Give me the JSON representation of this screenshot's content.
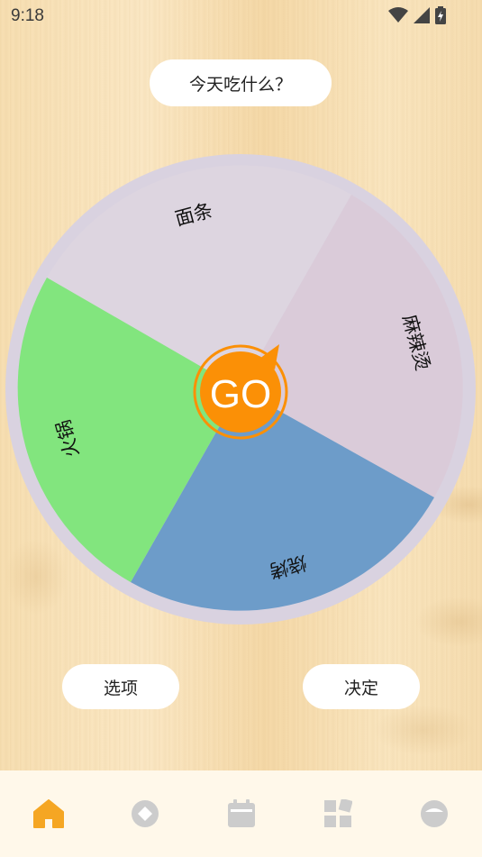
{
  "status": {
    "time": "9:18"
  },
  "header": {
    "title": "今天吃什么？"
  },
  "wheel": {
    "go_label": "GO",
    "segments": [
      {
        "label": "面条",
        "color": "#ddd5e0"
      },
      {
        "label": "麻辣烫",
        "color": "#dacbd9"
      },
      {
        "label": "烧烤",
        "color": "#6d9cc9"
      },
      {
        "label": "火锅",
        "color": "#82e57e"
      }
    ],
    "rim_color": "#d9d2e0",
    "go_color": "#fb9006"
  },
  "actions": {
    "options_label": "选项",
    "decide_label": "决定"
  },
  "nav": {
    "items": [
      {
        "icon": "home-icon",
        "active": true
      },
      {
        "icon": "compass-icon",
        "active": false
      },
      {
        "icon": "calendar-icon",
        "active": false
      },
      {
        "icon": "apps-icon",
        "active": false
      },
      {
        "icon": "profile-icon",
        "active": false
      }
    ],
    "active_color": "#f5a623",
    "inactive_color": "#cccccc"
  }
}
